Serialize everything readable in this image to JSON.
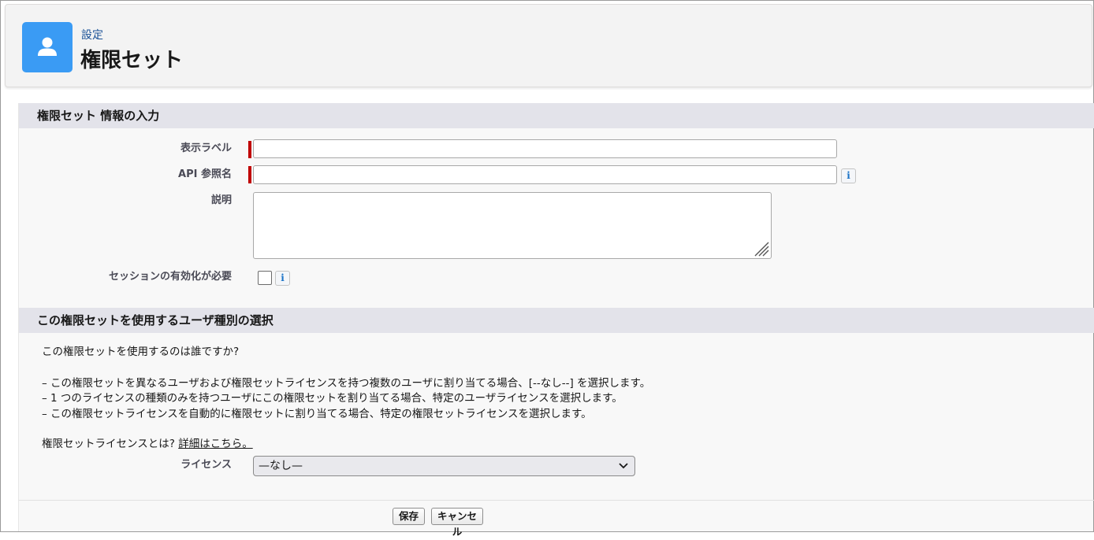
{
  "header": {
    "breadcrumb": "設定",
    "title": "権限セット",
    "icon": "user-icon",
    "accent_color": "#3a9bf4"
  },
  "section1": {
    "title": "権限セット 情報の入力",
    "fields": {
      "label": {
        "label": "表示ラベル",
        "value": ""
      },
      "api_name": {
        "label": "API 参照名",
        "value": ""
      },
      "description": {
        "label": "説明",
        "value": ""
      },
      "session": {
        "label": "セッションの有効化が必要",
        "checked": false
      }
    }
  },
  "section2": {
    "title": "この権限セットを使用するユーザ種別の選択",
    "question": "この権限セットを使用するのは誰ですか?",
    "bullets": [
      "– この権限セットを異なるユーザおよび権限セットライセンスを持つ複数のユーザに割り当てる場合、[--なし--] を選択します。",
      "– 1 つのライセンスの種類のみを持つユーザにこの権限セットを割り当てる場合、特定のユーザライセンスを選択します。",
      "– この権限セットライセンスを自動的に権限セットに割り当てる場合、特定の権限セットライセンスを選択します。"
    ],
    "license_question": "権限セットライセンスとは?",
    "details_link": "詳細はこちら。",
    "license_label": "ライセンス",
    "license_value": "—なし—"
  },
  "buttons": {
    "save": "保存",
    "cancel": "キャンセル"
  },
  "colors": {
    "required": "#c00000",
    "section_bg": "#e3e3ea",
    "link": "#1b5297"
  }
}
